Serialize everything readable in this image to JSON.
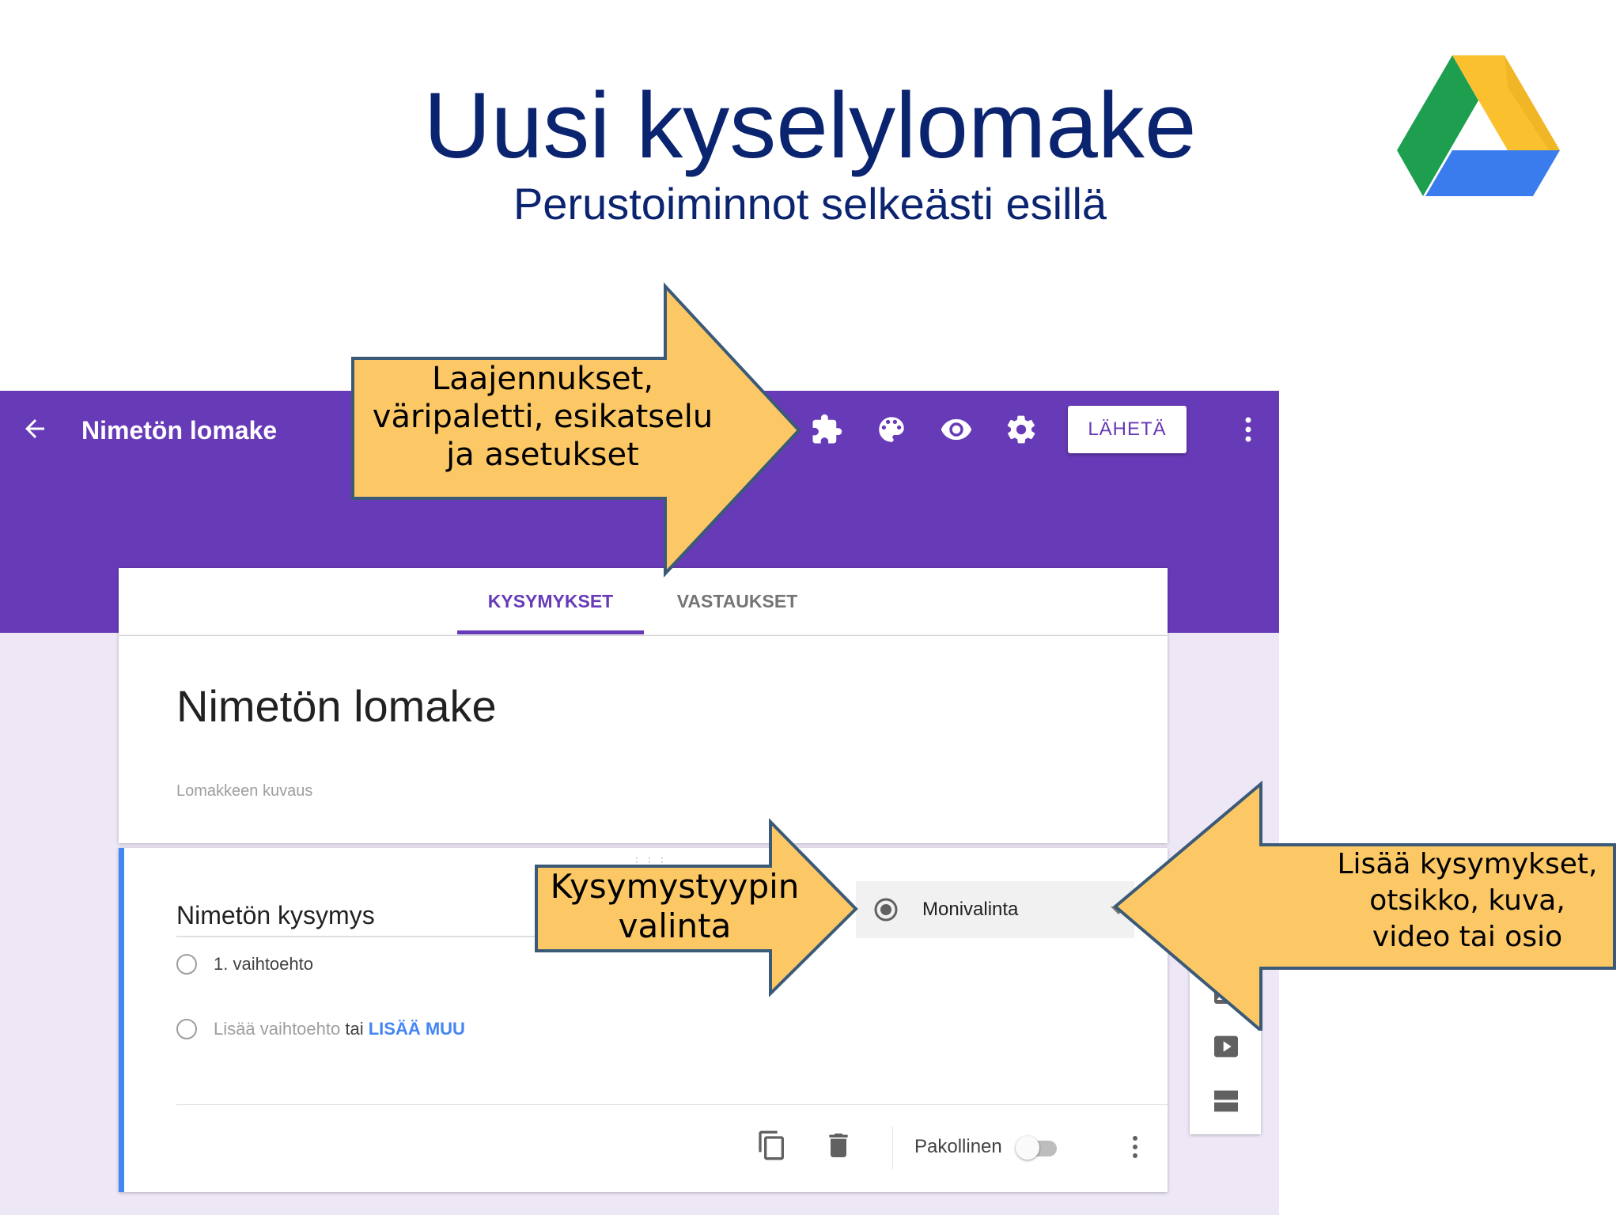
{
  "slide": {
    "title": "Uusi kyselylomake",
    "subtitle": "Perustoiminnot selkeästi esillä"
  },
  "appbar": {
    "form_name": "Nimetön lomake",
    "send_label": "LÄHETÄ",
    "icons": [
      "back-arrow-icon",
      "puzzle-icon",
      "palette-icon",
      "eye-icon",
      "gear-icon",
      "more-vert-icon"
    ],
    "color": "#673ab7"
  },
  "tabs": [
    {
      "label": "KYSYMYKSET",
      "active": true
    },
    {
      "label": "VASTAUKSET",
      "active": false
    }
  ],
  "form": {
    "title": "Nimetön lomake",
    "description_placeholder": "Lomakkeen kuvaus"
  },
  "question": {
    "title": "Nimetön kysymys",
    "type": "Monivalinta",
    "options": [
      "1. vaihtoehto"
    ],
    "add_option": "Lisää vaihtoehto",
    "or": "tai",
    "add_other": "LISÄÄ MUU",
    "required_label": "Pakollinen",
    "required": false,
    "accent_color": "#4285f4"
  },
  "side_toolbar": {
    "icons": [
      "add-circle-icon",
      "title-text-icon",
      "image-icon",
      "video-icon",
      "section-icon"
    ]
  },
  "callouts": {
    "top": [
      "Laajennukset,",
      "väripaletti, esikatselu",
      "ja asetukset"
    ],
    "middle": [
      "Kysymystyypin",
      "valinta"
    ],
    "right": [
      "Lisää kysymykset,",
      "otsikko, kuva,",
      "video tai osio"
    ],
    "fill": "#fcc866",
    "stroke": "#3b5a78"
  }
}
